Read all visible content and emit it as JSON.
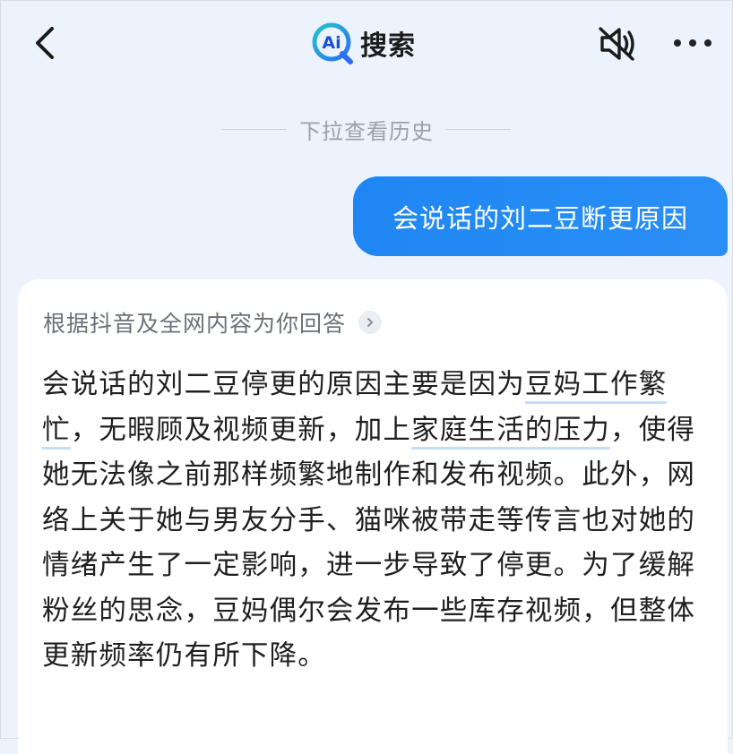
{
  "header": {
    "brand_text": "搜索",
    "logo_text": "Ai"
  },
  "history_hint": "下拉查看历史",
  "user_message": "会说话的刘二豆断更原因",
  "answer": {
    "source_label": "根据抖音及全网内容为你回答",
    "p1": "会说话的刘二豆停更的原因主要是因为",
    "hl1": "豆妈工作繁忙",
    "p2": "，无暇顾及视频更新，加上",
    "hl2": "家庭生活的压力",
    "p3": "，使得她无法像之前那样频繁地制作和发布视频。此外，网络上关于她与男友分手、猫咪被带走等传言也对她的情绪产生了一定影响，进一步导致了停更。为了缓解粉丝的思念，豆妈偶尔会发布一些库存视频，但整体更新频率仍有所下降。"
  },
  "colors": {
    "background": "#edf3fc",
    "bubble": "#1f86f3",
    "logo_blue": "#2f8cf5",
    "logo_teal": "#22c6c8"
  },
  "icons": [
    "back-arrow-icon",
    "ai-search-logo-icon",
    "speaker-muted-icon",
    "more-dots-icon",
    "chevron-right-icon"
  ]
}
